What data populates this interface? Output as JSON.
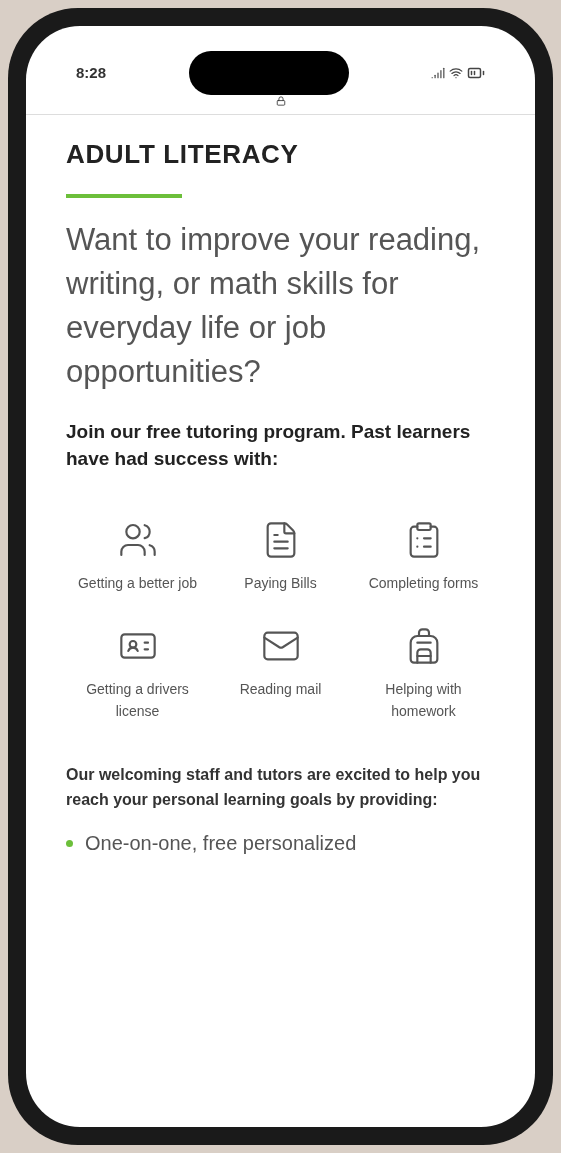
{
  "status_bar": {
    "time": "8:28"
  },
  "page": {
    "title": "ADULT LITERACY",
    "lead": "Want to improve your reading, writing, or math skills for everyday life or job opportunities?",
    "intro": "Join our free tutoring program. Past learners have had success with:",
    "successes": [
      {
        "label": "Getting a better job"
      },
      {
        "label": "Paying Bills"
      },
      {
        "label": "Completing forms"
      },
      {
        "label": "Getting a drivers license"
      },
      {
        "label": "Reading mail"
      },
      {
        "label": "Helping with homework"
      }
    ],
    "staff_text": "Our welcoming staff and tutors are excited to help you reach your personal learning goals by providing:",
    "bullets": [
      "One-on-one, free personalized"
    ]
  }
}
